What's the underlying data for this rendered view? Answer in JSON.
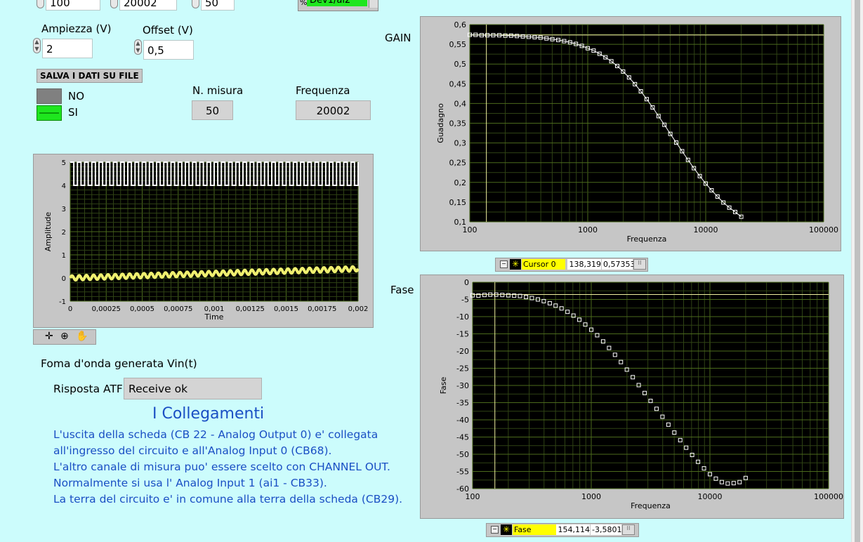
{
  "top": {
    "val1": "100",
    "val2": "20002",
    "val3": "50",
    "channel": "Dev1/ai2",
    "channel_prefix": "%"
  },
  "ampiezza": {
    "label": "Ampiezza (V)",
    "value": "2"
  },
  "offset": {
    "label": "Offset (V)",
    "value": "0,5"
  },
  "salva": {
    "title": "SALVA I DATI SU FILE",
    "no": "NO",
    "si": "SI"
  },
  "nmisura": {
    "label": "N. misura",
    "value": "50"
  },
  "frequenza": {
    "label": "Frequenza",
    "value": "20002"
  },
  "vin_caption": "Foma d'onda generata Vin(t)",
  "atf": {
    "label": "Risposta ATF",
    "value": "Receive ok"
  },
  "collegamenti": {
    "title": "I Collegamenti",
    "lines": [
      "L'uscita della scheda (CB 22 - Analog Output 0) e' collegata",
      "all'ingresso del circuito e all'Analog Input 0 (CB68).",
      "L'altro canale di misura puo' essere scelto con CHANNEL OUT.",
      "Normalmente si usa l' Analog Input 1 (ai1 - CB33).",
      "La terra del circuito e' in comune alla terra della scheda (CB29)."
    ]
  },
  "gain_caption": "GAIN",
  "fase_caption": "Fase",
  "cursor_gain": {
    "name": "Cursor 0",
    "x": "138,319",
    "y": "0,57353"
  },
  "cursor_fase": {
    "name": "Fase",
    "x": "154,114",
    "y": "-3,5801"
  },
  "colors": {
    "bg": "#ccfcfc",
    "plot": "#000000",
    "grid": "#4b6a1c",
    "minor": "#2f4214",
    "trace": "#f0f070",
    "cursor": "#f0f0a0",
    "led_on": "#1ee61e",
    "led_off": "#808080",
    "cursor_label": "#ffff00",
    "info_text": "#1a4fc4"
  },
  "chart_data": [
    {
      "type": "line",
      "xlabel": "Time",
      "ylabel": "Amplitude",
      "xlim": [
        0,
        0.002
      ],
      "ylim": [
        -1,
        5
      ],
      "x_ticks": [
        "0",
        "0,00025",
        "0,0005",
        "0,00075",
        "0,001",
        "0,00125",
        "0,0015",
        "0,00175",
        "0,002"
      ],
      "y_ticks": [
        "5",
        "4",
        "3",
        "2",
        "1",
        "0",
        "-1"
      ],
      "series": [
        {
          "kind": "square_wave",
          "low": 4,
          "high": 5,
          "cycles": 40,
          "color": "white"
        },
        {
          "kind": "sine_ramp",
          "start": 0.0,
          "end": 0.4,
          "amplitude": 0.1,
          "cycles": 40,
          "color": "yellow"
        }
      ]
    },
    {
      "type": "scatter",
      "xlabel": "Frequenza",
      "ylabel": "Guadagno",
      "xscale": "log",
      "xlim": [
        100,
        100000
      ],
      "ylim": [
        0.1,
        0.6
      ],
      "x_ticks": [
        "100",
        "1000",
        "10000",
        "100000"
      ],
      "y_ticks": [
        "0,6",
        "0,55",
        "0,5",
        "0,45",
        "0,4",
        "0,35",
        "0,3",
        "0,25",
        "0,2",
        "0,15",
        "0,1"
      ],
      "cursor": {
        "x": 138.319,
        "y": 0.57353
      },
      "x": [
        100,
        112,
        126,
        141,
        158,
        178,
        200,
        224,
        251,
        282,
        316,
        355,
        398,
        447,
        501,
        562,
        631,
        708,
        794,
        891,
        1000,
        1122,
        1259,
        1413,
        1585,
        1778,
        1995,
        2239,
        2512,
        2818,
        3162,
        3548,
        3981,
        4467,
        5012,
        5623,
        6310,
        7079,
        7943,
        8913,
        10000,
        11220,
        12589,
        14125,
        15849,
        17783,
        20002
      ],
      "y": [
        0.574,
        0.574,
        0.573,
        0.573,
        0.573,
        0.573,
        0.572,
        0.572,
        0.571,
        0.57,
        0.569,
        0.568,
        0.567,
        0.565,
        0.563,
        0.561,
        0.558,
        0.555,
        0.551,
        0.546,
        0.54,
        0.534,
        0.526,
        0.517,
        0.507,
        0.495,
        0.481,
        0.466,
        0.449,
        0.431,
        0.411,
        0.39,
        0.368,
        0.346,
        0.323,
        0.301,
        0.279,
        0.257,
        0.236,
        0.216,
        0.197,
        0.18,
        0.164,
        0.149,
        0.136,
        0.125,
        0.113
      ]
    },
    {
      "type": "scatter",
      "xlabel": "Frequenza",
      "ylabel": "Fase",
      "xscale": "log",
      "xlim": [
        100,
        100000
      ],
      "ylim": [
        -60,
        0
      ],
      "x_ticks": [
        "100",
        "1000",
        "10000",
        "100000"
      ],
      "y_ticks": [
        "0",
        "-5",
        "-10",
        "-15",
        "-20",
        "-25",
        "-30",
        "-35",
        "-40",
        "-45",
        "-50",
        "-55",
        "-60"
      ],
      "cursor": {
        "x": 154.114,
        "y": -3.5801
      },
      "x": [
        100,
        112,
        126,
        141,
        158,
        178,
        200,
        224,
        251,
        282,
        316,
        355,
        398,
        447,
        501,
        562,
        631,
        708,
        794,
        891,
        1000,
        1122,
        1259,
        1413,
        1585,
        1778,
        1995,
        2239,
        2512,
        2818,
        3162,
        3548,
        3981,
        4467,
        5012,
        5623,
        6310,
        7079,
        7943,
        8913,
        10000,
        11220,
        12589,
        14125,
        15849,
        17783,
        20002
      ],
      "y": [
        -3.8,
        -3.9,
        -3.7,
        -3.6,
        -3.6,
        -3.7,
        -3.8,
        -3.9,
        -4.0,
        -4.3,
        -4.6,
        -5.0,
        -5.5,
        -6.1,
        -6.8,
        -7.6,
        -8.6,
        -9.7,
        -10.9,
        -12.3,
        -13.8,
        -15.4,
        -17.2,
        -19.1,
        -21.1,
        -23.2,
        -25.4,
        -27.6,
        -29.9,
        -32.2,
        -34.5,
        -36.8,
        -39.1,
        -41.4,
        -43.7,
        -45.9,
        -48.1,
        -50.2,
        -52.2,
        -54.1,
        -55.8,
        -57.1,
        -58.1,
        -58.5,
        -58.4,
        -58.1,
        -56.9
      ]
    }
  ]
}
